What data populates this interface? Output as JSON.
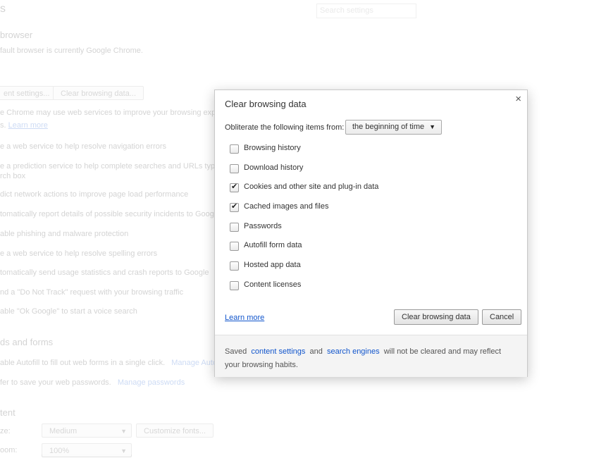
{
  "background": {
    "header_partial": "s",
    "search_placeholder": "Search settings",
    "default_browser": {
      "heading": "browser",
      "status": "fault browser is currently Google Chrome."
    },
    "privacy": {
      "content_settings_button": "ent settings...",
      "clear_data_button": "Clear browsing data...",
      "intro": "e Chrome may use web services to improve your browsing exper",
      "intro2": "s.",
      "learn_more": "Learn more",
      "items": [
        "e a web service to help resolve navigation errors",
        "e a prediction service to help complete searches and URLs typed",
        "rch box",
        "dict network actions to improve page load performance",
        "tomatically report details of possible security incidents to Google",
        "able phishing and malware protection",
        "e a web service to help resolve spelling errors",
        "tomatically send usage statistics and crash reports to Google",
        "nd a \"Do Not Track\" request with your browsing traffic",
        "able \"Ok Google\" to start a voice search"
      ]
    },
    "passwords": {
      "heading": "ds and forms",
      "autofill": "able Autofill to fill out web forms in a single click.",
      "autofill_link": "Manage Autof",
      "save_pw": "fer to save your web passwords.",
      "save_pw_link": "Manage passwords"
    },
    "web_content": {
      "heading": "tent",
      "font_size_label": "ze:",
      "font_size_value": "Medium",
      "customize_fonts": "Customize fonts...",
      "zoom_label": "oom:",
      "zoom_value": "100%"
    }
  },
  "dialog": {
    "title": "Clear browsing data",
    "close": "×",
    "obliterate_label": "Obliterate the following items from:",
    "range_value": "the beginning of time",
    "options": [
      {
        "label": "Browsing history",
        "checked": false
      },
      {
        "label": "Download history",
        "checked": false
      },
      {
        "label": "Cookies and other site and plug-in data",
        "checked": true
      },
      {
        "label": "Cached images and files",
        "checked": true
      },
      {
        "label": "Passwords",
        "checked": false
      },
      {
        "label": "Autofill form data",
        "checked": false
      },
      {
        "label": "Hosted app data",
        "checked": false
      },
      {
        "label": "Content licenses",
        "checked": false
      }
    ],
    "learn_more": "Learn more",
    "clear_button": "Clear browsing data",
    "cancel_button": "Cancel",
    "footer": {
      "saved": "Saved",
      "content_settings": "content settings",
      "and": "and",
      "search_engines": "search engines",
      "rest": "will not be cleared and may reflect your browsing habits."
    }
  }
}
